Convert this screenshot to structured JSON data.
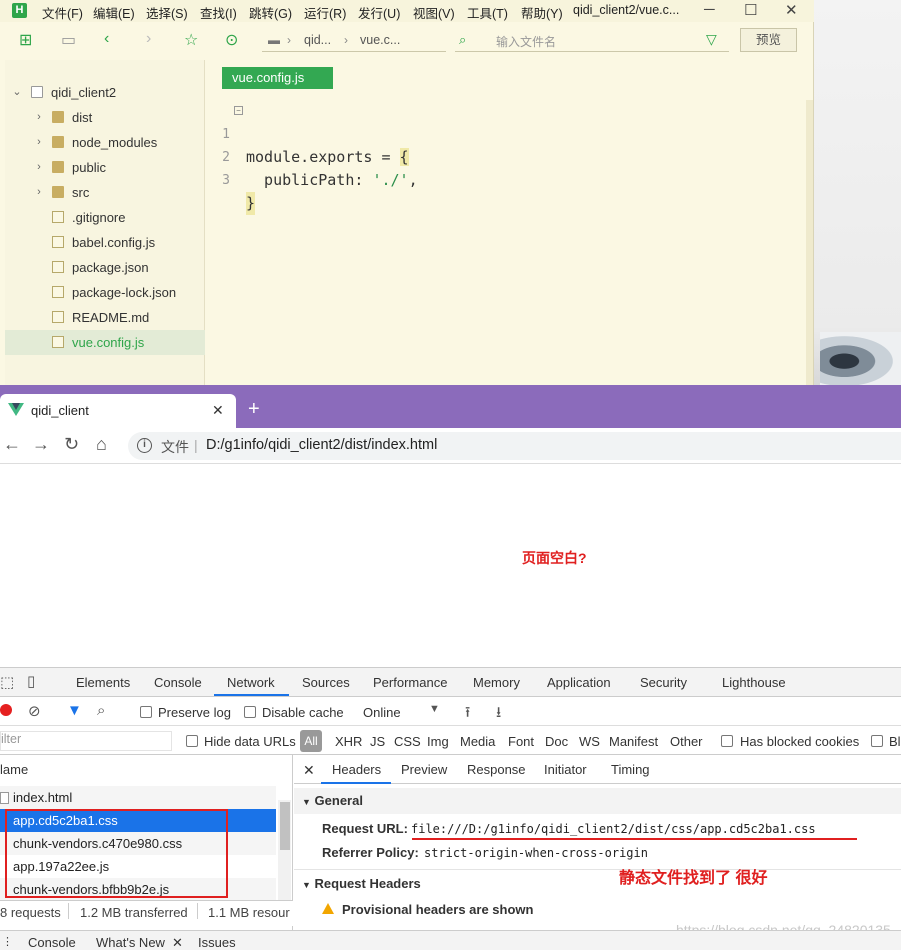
{
  "editor": {
    "app_logo": "H",
    "menu": [
      "文件(F)",
      "编辑(E)",
      "选择(S)",
      "查找(I)",
      "跳转(G)",
      "运行(R)",
      "发行(U)",
      "视图(V)",
      "工具(T)",
      "帮助(Y)"
    ],
    "window_title": "qidi_client2/vue.c...",
    "path_parts": [
      "qid...",
      "vue.c..."
    ],
    "file_search_placeholder": "输入文件名",
    "preview_label": "预览",
    "tree": {
      "root": "qidi_client2",
      "items": [
        {
          "label": "dist",
          "type": "folder"
        },
        {
          "label": "node_modules",
          "type": "folder"
        },
        {
          "label": "public",
          "type": "folder"
        },
        {
          "label": "src",
          "type": "folder"
        },
        {
          "label": ".gitignore",
          "type": "file"
        },
        {
          "label": "babel.config.js",
          "type": "file"
        },
        {
          "label": "package.json",
          "type": "file"
        },
        {
          "label": "package-lock.json",
          "type": "file"
        },
        {
          "label": "README.md",
          "type": "file"
        },
        {
          "label": "vue.config.js",
          "type": "file",
          "active": true
        }
      ]
    },
    "active_tab": "vue.config.js",
    "code": [
      {
        "n": "1",
        "text": "module.exports = {"
      },
      {
        "n": "2",
        "text": "  publicPath: './',"
      },
      {
        "n": "3",
        "text": "}"
      }
    ]
  },
  "browser": {
    "tab_title": "qidi_client",
    "url_label": "文件",
    "url_separator": "|",
    "url": "D:/g1info/qidi_client2/dist/index.html",
    "page_note": "页面空白?"
  },
  "devtools": {
    "tabs": [
      "Elements",
      "Console",
      "Network",
      "Sources",
      "Performance",
      "Memory",
      "Application",
      "Security",
      "Lighthouse"
    ],
    "active_tab": "Network",
    "preserve_log": "Preserve log",
    "disable_cache": "Disable cache",
    "throttle": "Online",
    "filter_placeholder": "ilter",
    "hide_data_urls": "Hide data URLs",
    "all_label": "All",
    "type_filters": [
      "XHR",
      "JS",
      "CSS",
      "Img",
      "Media",
      "Font",
      "Doc",
      "WS",
      "Manifest",
      "Other"
    ],
    "blocked_cookies": "Has blocked cookies",
    "blocked_cut": "Bl",
    "name_header": "lame",
    "requests": [
      {
        "name": "index.html"
      },
      {
        "name": "app.cd5c2ba1.css",
        "selected": true
      },
      {
        "name": "chunk-vendors.c470e980.css"
      },
      {
        "name": "app.197a22ee.js"
      },
      {
        "name": "chunk-vendors.bfbb9b2e.js"
      }
    ],
    "status": {
      "requests": "8 requests",
      "transferred": "1.2 MB transferred",
      "resources": "1.1 MB resour"
    },
    "detail_tabs": [
      "Headers",
      "Preview",
      "Response",
      "Initiator",
      "Timing"
    ],
    "detail_active": "Headers",
    "general_title": "General",
    "request_url_key": "Request URL:",
    "request_url_val": "file:///D:/g1info/qidi_client2/dist/css/app.cd5c2ba1.css",
    "referrer_key": "Referrer Policy:",
    "referrer_val": "strict-origin-when-cross-origin",
    "request_headers_title": "Request Headers",
    "provisional": "Provisional headers are shown",
    "annotation": "静态文件找到了 很好",
    "watermark": "https://blog.csdn.net/qq_24820135",
    "drawer_tabs": [
      "Console",
      "What's New",
      "Issues"
    ]
  },
  "colors": {
    "accent_green": "#2fa54a",
    "chrome_purple": "#8b6bbb",
    "selection_blue": "#1a73e8",
    "annotation_red": "#e02020"
  }
}
